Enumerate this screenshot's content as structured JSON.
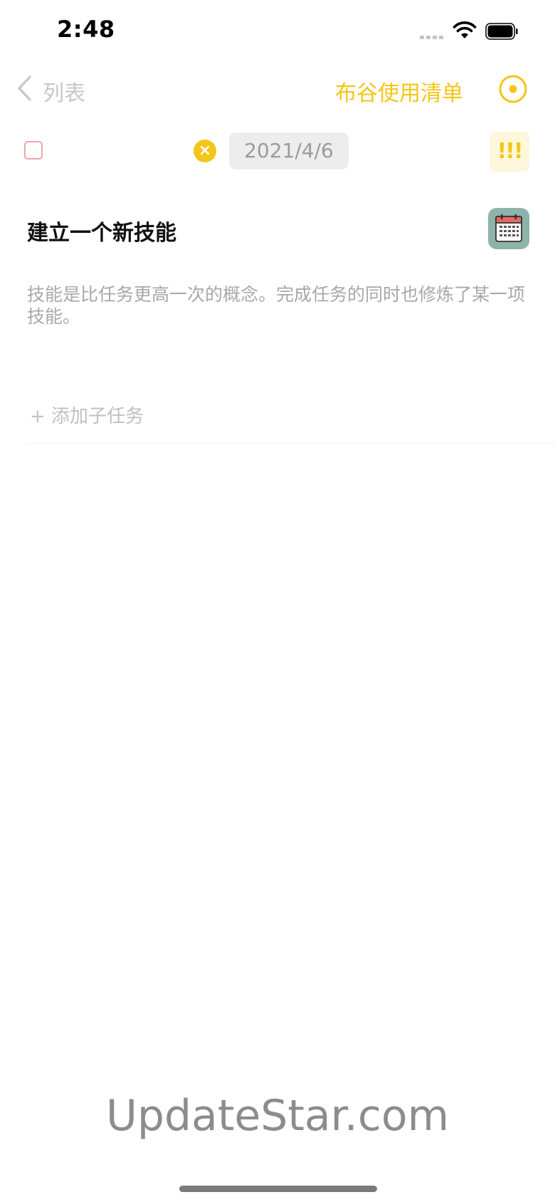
{
  "status_bar": {
    "time": "2:48",
    "icons": [
      "signal-icon",
      "wifi-icon",
      "battery-icon"
    ]
  },
  "nav": {
    "back_label": "列表",
    "list_title": "布谷使用清单",
    "back_icon": "chevron-left-icon",
    "target_icon": "target-icon"
  },
  "task": {
    "date": "2021/4/6",
    "clear_symbol": "×",
    "priority": "!!!",
    "title": "建立一个新技能",
    "description": "技能是比任务更高一次的概念。完成任务的同时也修炼了某一项技能。",
    "add_subtask": "+ 添加子任务",
    "skill_icon": "calendar-icon"
  },
  "watermark": "UpdateStar.com",
  "colors": {
    "accent": "#f5c518",
    "checkbox_border": "#f0a6a8",
    "muted_text": "#a8a8a8",
    "skill_badge": "#8db3aa"
  }
}
